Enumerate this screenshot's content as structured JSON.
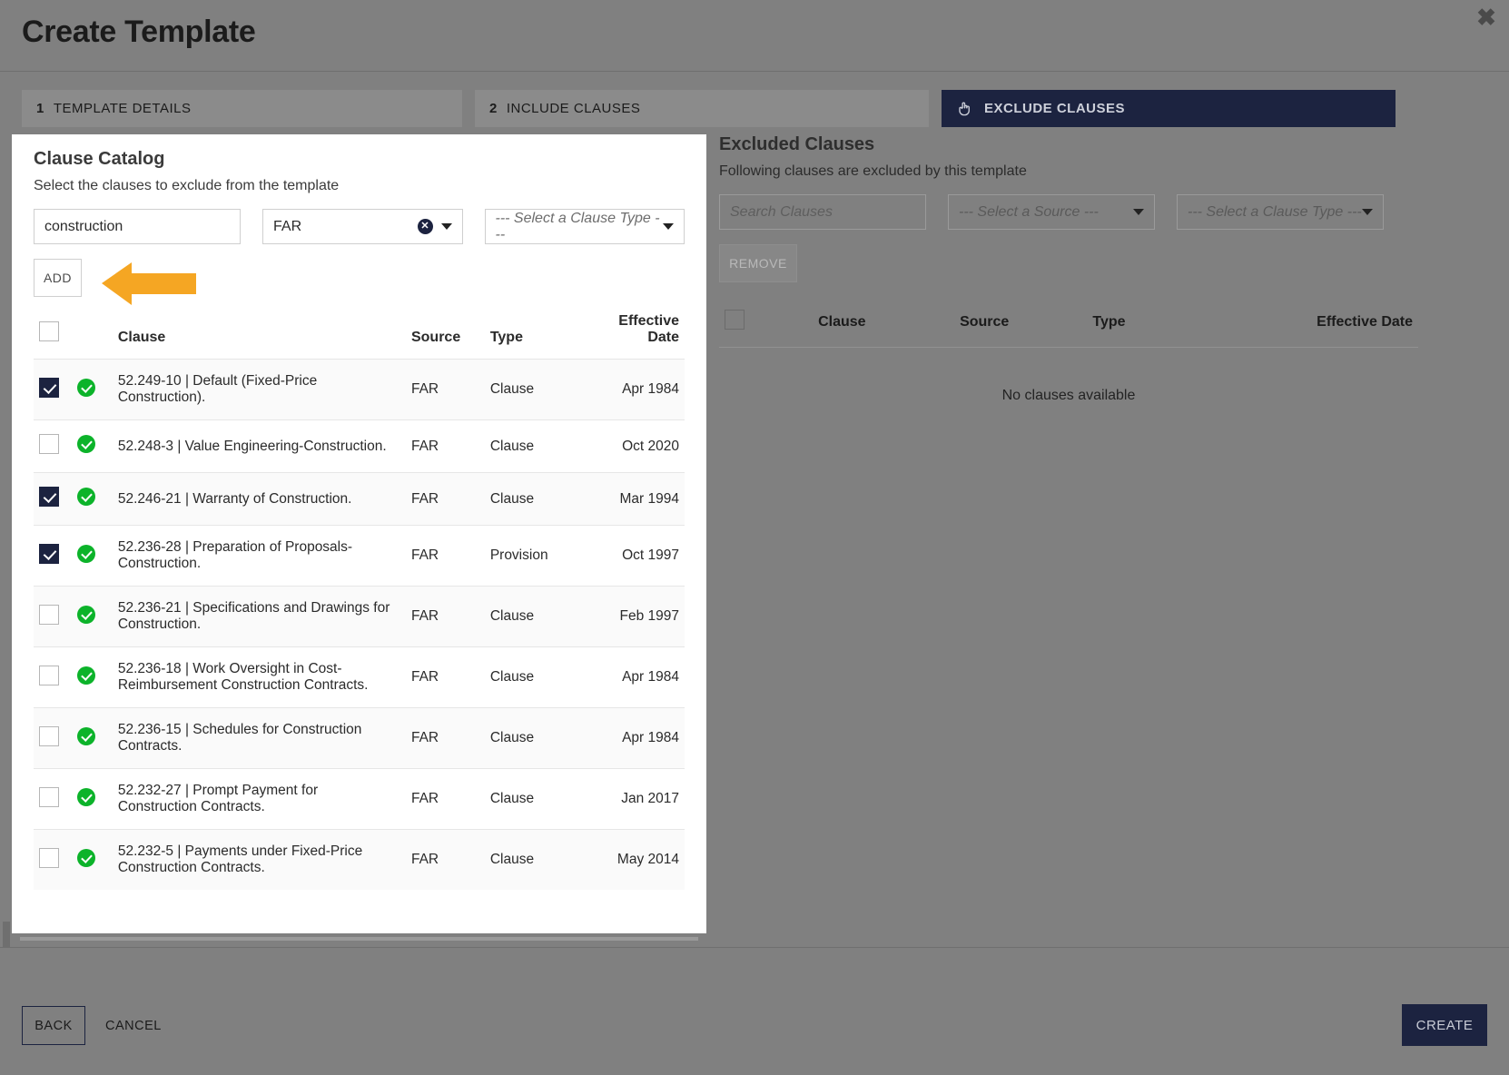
{
  "window": {
    "title": "Create Template",
    "close_icon": "close-icon"
  },
  "steps": [
    {
      "num": "1",
      "label": "TEMPLATE DETAILS",
      "active": false
    },
    {
      "num": "2",
      "label": "INCLUDE CLAUSES",
      "active": false
    },
    {
      "num": "",
      "label": "EXCLUDE CLAUSES",
      "active": true,
      "icon": "pointing-hand-icon"
    }
  ],
  "clause_catalog": {
    "title": "Clause Catalog",
    "subtitle": "Select the clauses to exclude from the template",
    "search_value": "construction",
    "search_placeholder": "Search Clauses",
    "source_value": "FAR",
    "clause_type_placeholder": "--- Select a Clause Type ---",
    "add_label": "ADD",
    "columns": {
      "clause": "Clause",
      "source": "Source",
      "type": "Type",
      "effective_date": "Effective Date"
    },
    "rows": [
      {
        "checked": true,
        "status": "valid",
        "clause": "52.249-10 | Default (Fixed-Price Construction).",
        "source": "FAR",
        "type": "Clause",
        "date": "Apr 1984"
      },
      {
        "checked": false,
        "status": "valid",
        "clause": "52.248-3 | Value Engineering-Construction.",
        "source": "FAR",
        "type": "Clause",
        "date": "Oct 2020"
      },
      {
        "checked": true,
        "status": "valid",
        "clause": "52.246-21 | Warranty of Construction.",
        "source": "FAR",
        "type": "Clause",
        "date": "Mar 1994"
      },
      {
        "checked": true,
        "status": "valid",
        "clause": "52.236-28 | Preparation of Proposals-Construction.",
        "source": "FAR",
        "type": "Provision",
        "date": "Oct 1997"
      },
      {
        "checked": false,
        "status": "valid",
        "clause": "52.236-21 | Specifications and Drawings for Construction.",
        "source": "FAR",
        "type": "Clause",
        "date": "Feb 1997"
      },
      {
        "checked": false,
        "status": "valid",
        "clause": "52.236-18 | Work Oversight in Cost-Reimbursement Construction Contracts.",
        "source": "FAR",
        "type": "Clause",
        "date": "Apr 1984"
      },
      {
        "checked": false,
        "status": "valid",
        "clause": "52.236-15 | Schedules for Construction Contracts.",
        "source": "FAR",
        "type": "Clause",
        "date": "Apr 1984"
      },
      {
        "checked": false,
        "status": "valid",
        "clause": "52.232-27 | Prompt Payment for Construction Contracts.",
        "source": "FAR",
        "type": "Clause",
        "date": "Jan 2017"
      },
      {
        "checked": false,
        "status": "valid",
        "clause": "52.232-5 | Payments under Fixed-Price Construction Contracts.",
        "source": "FAR",
        "type": "Clause",
        "date": "May 2014"
      }
    ]
  },
  "excluded_clauses": {
    "title": "Excluded Clauses",
    "subtitle": "Following clauses are excluded by this template",
    "search_placeholder": "Search Clauses",
    "source_placeholder": "--- Select a Source ---",
    "clause_type_placeholder": "--- Select a Clause Type ---",
    "remove_label": "REMOVE",
    "columns": {
      "clause": "Clause",
      "source": "Source",
      "type": "Type",
      "effective_date": "Effective Date"
    },
    "empty_message": "No clauses available"
  },
  "footer": {
    "back_label": "BACK",
    "cancel_label": "CANCEL",
    "create_label": "CREATE"
  },
  "annotation": {
    "arrow_color": "#f5a623",
    "arrow_points_to": "ADD"
  },
  "colors": {
    "accent_navy": "#1c2340",
    "status_green": "#0cb32a",
    "page_bg": "#808080",
    "panel_bg": "#ffffff"
  }
}
